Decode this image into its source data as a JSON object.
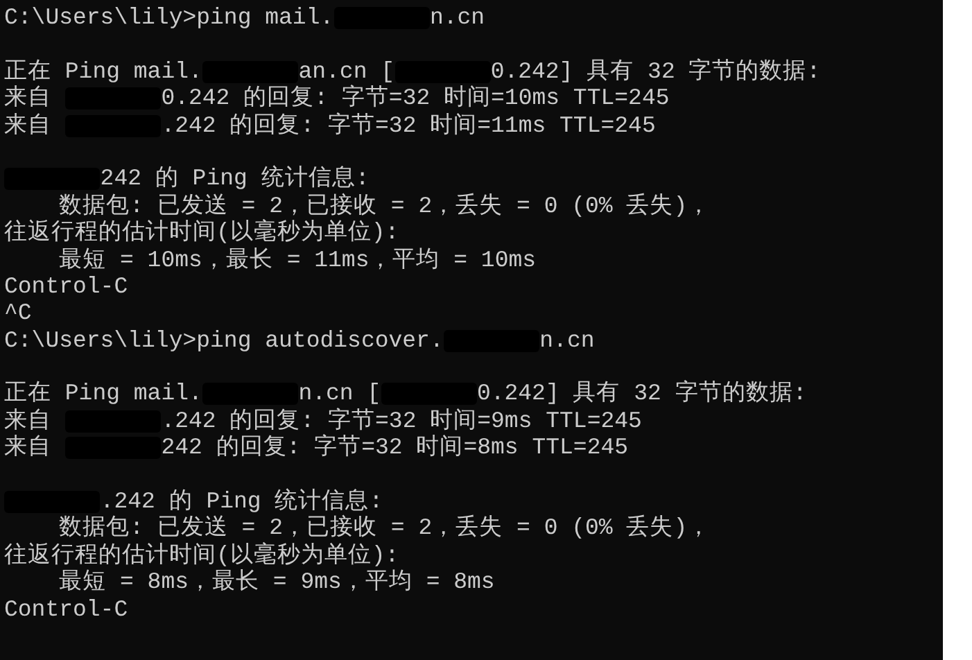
{
  "terminal": {
    "lines": [
      {
        "kind": "text",
        "parts": [
          {
            "kind": "text",
            "text": "C:\\Users\\lily>ping mail."
          },
          {
            "kind": "redaction"
          },
          {
            "kind": "text",
            "text": "n.cn"
          }
        ]
      },
      {
        "kind": "blank"
      },
      {
        "kind": "text",
        "parts": [
          {
            "kind": "text",
            "text": "正在 Ping mail."
          },
          {
            "kind": "redaction"
          },
          {
            "kind": "text",
            "text": "an.cn ["
          },
          {
            "kind": "redaction"
          },
          {
            "kind": "text",
            "text": "0.242] 具有 32 字节的数据:"
          }
        ]
      },
      {
        "kind": "text",
        "parts": [
          {
            "kind": "text",
            "text": "来自 "
          },
          {
            "kind": "redaction"
          },
          {
            "kind": "text",
            "text": "0.242 的回复: 字节=32 时间=10ms TTL=245"
          }
        ]
      },
      {
        "kind": "text",
        "parts": [
          {
            "kind": "text",
            "text": "来自 "
          },
          {
            "kind": "redaction"
          },
          {
            "kind": "text",
            "text": ".242 的回复: 字节=32 时间=11ms TTL=245"
          }
        ]
      },
      {
        "kind": "blank"
      },
      {
        "kind": "text",
        "parts": [
          {
            "kind": "redaction"
          },
          {
            "kind": "text",
            "text": "242 的 Ping 统计信息:"
          }
        ]
      },
      {
        "kind": "text",
        "parts": [
          {
            "kind": "text",
            "text": "    数据包: 已发送 = 2，已接收 = 2，丢失 = 0 (0% 丢失)，"
          }
        ]
      },
      {
        "kind": "text",
        "parts": [
          {
            "kind": "text",
            "text": "往返行程的估计时间(以毫秒为单位):"
          }
        ]
      },
      {
        "kind": "text",
        "parts": [
          {
            "kind": "text",
            "text": "    最短 = 10ms，最长 = 11ms，平均 = 10ms"
          }
        ]
      },
      {
        "kind": "text",
        "parts": [
          {
            "kind": "text",
            "text": "Control-C"
          }
        ]
      },
      {
        "kind": "text",
        "parts": [
          {
            "kind": "text",
            "text": "^C"
          }
        ]
      },
      {
        "kind": "text",
        "parts": [
          {
            "kind": "text",
            "text": "C:\\Users\\lily>ping autodiscover."
          },
          {
            "kind": "redaction"
          },
          {
            "kind": "text",
            "text": "n.cn"
          }
        ]
      },
      {
        "kind": "blank"
      },
      {
        "kind": "text",
        "parts": [
          {
            "kind": "text",
            "text": "正在 Ping mail."
          },
          {
            "kind": "redaction"
          },
          {
            "kind": "text",
            "text": "n.cn ["
          },
          {
            "kind": "redaction"
          },
          {
            "kind": "text",
            "text": "0.242] 具有 32 字节的数据:"
          }
        ]
      },
      {
        "kind": "text",
        "parts": [
          {
            "kind": "text",
            "text": "来自 "
          },
          {
            "kind": "redaction"
          },
          {
            "kind": "text",
            "text": ".242 的回复: 字节=32 时间=9ms TTL=245"
          }
        ]
      },
      {
        "kind": "text",
        "parts": [
          {
            "kind": "text",
            "text": "来自 "
          },
          {
            "kind": "redaction"
          },
          {
            "kind": "text",
            "text": "242 的回复: 字节=32 时间=8ms TTL=245"
          }
        ]
      },
      {
        "kind": "blank"
      },
      {
        "kind": "text",
        "parts": [
          {
            "kind": "redaction"
          },
          {
            "kind": "text",
            "text": ".242 的 Ping 统计信息:"
          }
        ]
      },
      {
        "kind": "text",
        "parts": [
          {
            "kind": "text",
            "text": "    数据包: 已发送 = 2，已接收 = 2，丢失 = 0 (0% 丢失)，"
          }
        ]
      },
      {
        "kind": "text",
        "parts": [
          {
            "kind": "text",
            "text": "往返行程的估计时间(以毫秒为单位):"
          }
        ]
      },
      {
        "kind": "text",
        "parts": [
          {
            "kind": "text",
            "text": "    最短 = 8ms，最长 = 9ms，平均 = 8ms"
          }
        ]
      },
      {
        "kind": "text",
        "parts": [
          {
            "kind": "text",
            "text": "Control-C"
          }
        ]
      }
    ]
  }
}
